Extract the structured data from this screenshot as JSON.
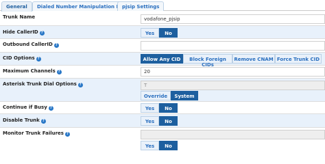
{
  "tabs": [
    {
      "label": "General"
    },
    {
      "label": "Dialed Number Manipulation Rules"
    },
    {
      "label": "pjsip Settings"
    }
  ],
  "fields": {
    "trunk_name": {
      "label": "Trunk Name",
      "value": "vodafone_pjsip"
    },
    "hide_callerid": {
      "label": "Hide CallerID",
      "yes": "Yes",
      "no": "No",
      "selected": "No"
    },
    "outbound_callerid": {
      "label": "Outbound CallerID",
      "value": ""
    },
    "cid_options": {
      "label": "CID Options",
      "options": [
        "Allow Any CID",
        "Block Foreign CIDs",
        "Remove CNAM",
        "Force Trunk CID"
      ],
      "selected": "Allow Any CID"
    },
    "maximum_channels": {
      "label": "Maximum Channels",
      "value": "20"
    },
    "asterisk_dial_options": {
      "label": "Asterisk Trunk Dial Options",
      "value": "T",
      "override": "Override",
      "system": "System",
      "selected": "System"
    },
    "continue_if_busy": {
      "label": "Continue if Busy",
      "yes": "Yes",
      "no": "No",
      "selected": "No"
    },
    "disable_trunk": {
      "label": "Disable Trunk",
      "yes": "Yes",
      "no": "No",
      "selected": "No"
    },
    "monitor_trunk_failures": {
      "label": "Monitor Trunk Failures",
      "value": "",
      "yes": "Yes",
      "no": "No",
      "selected": "No"
    }
  },
  "help_glyph": "?",
  "colors": {
    "accent": "#1d5f9f",
    "row_alt": "#e8f1fb",
    "link": "#2a6fbf"
  }
}
